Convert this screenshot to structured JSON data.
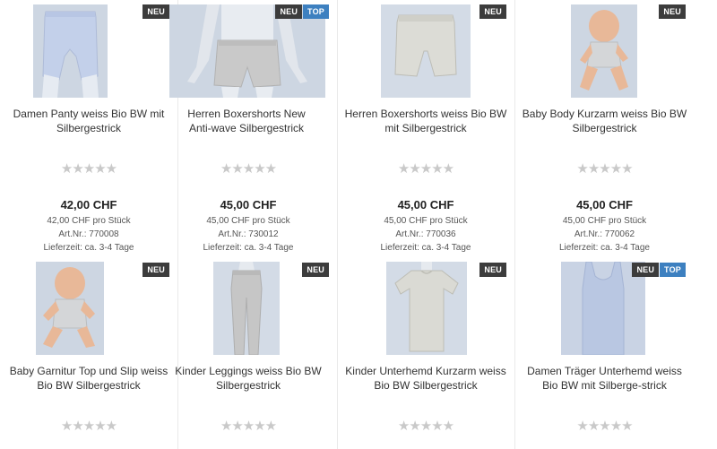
{
  "products": [
    {
      "title": "Damen Panty weiss Bio BW mit Silbergestrick",
      "badges": [
        "NEU"
      ],
      "price": "42,00 CHF",
      "unit_price": "42,00 CHF pro Stück",
      "article": "Art.Nr.: 770008",
      "delivery": "Lieferzeit: ca. 3-4 Tage",
      "stars": "★★★★★",
      "image": "panty"
    },
    {
      "title": "Herren Boxershorts New Anti-wave Silbergestrick",
      "badges": [
        "NEU",
        "TOP"
      ],
      "price": "45,00 CHF",
      "unit_price": "45,00 CHF pro Stück",
      "article": "Art.Nr.: 730012",
      "delivery": "Lieferzeit: ca. 3-4 Tage",
      "stars": "★★★★★",
      "image": "boxer-mannequin"
    },
    {
      "title": "Herren Boxershorts weiss Bio BW mit Silbergestrick",
      "badges": [
        "NEU"
      ],
      "price": "45,00 CHF",
      "unit_price": "45,00 CHF pro Stück",
      "article": "Art.Nr.: 770036",
      "delivery": "Lieferzeit: ca. 3-4 Tage",
      "stars": "★★★★★",
      "image": "boxer"
    },
    {
      "title": "Baby Body Kurzarm weiss Bio BW Silbergestrick",
      "badges": [
        "NEU"
      ],
      "price": "45,00 CHF",
      "unit_price": "45,00 CHF pro Stück",
      "article": "Art.Nr.: 770062",
      "delivery": "Lieferzeit: ca. 3-4 Tage",
      "stars": "★★★★★",
      "image": "baby-body"
    },
    {
      "title": "Baby Garnitur Top und Slip weiss Bio BW Silbergestrick",
      "badges": [
        "NEU"
      ],
      "stars": "★★★★★",
      "image": "baby-set"
    },
    {
      "title": "Kinder Leggings weiss Bio BW Silbergestrick",
      "badges": [
        "NEU"
      ],
      "stars": "★★★★★",
      "image": "leggings"
    },
    {
      "title": "Kinder Unterhemd Kurzarm weiss Bio BW Silbergestrick",
      "badges": [
        "NEU"
      ],
      "stars": "★★★★★",
      "image": "tshirt"
    },
    {
      "title": "Damen Träger Unterhemd weiss Bio BW mit Silberge-strick",
      "badges": [
        "NEU",
        "TOP"
      ],
      "stars": "★★★★★",
      "image": "tank"
    }
  ],
  "colors": {
    "neu_badge": "#3c3c3c",
    "top_badge": "#3d80c0",
    "image_bg": "#cdd6e2",
    "star": "#c9c9c9"
  }
}
